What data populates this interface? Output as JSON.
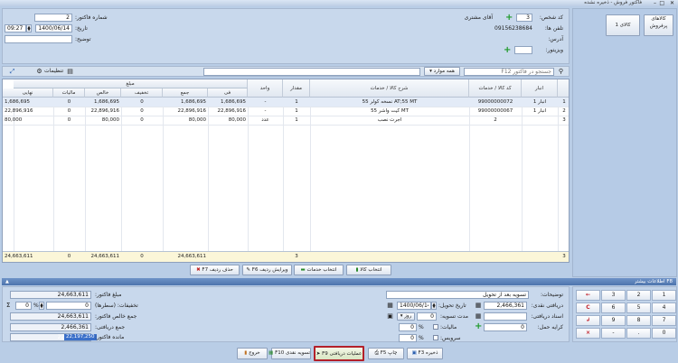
{
  "window": {
    "title": "فاکتور فروش - ذخیره نشده"
  },
  "header": {
    "invoice_number_label": "شماره فاکتور:",
    "invoice_number": "2",
    "date_label": "تاریخ:",
    "date": "1400/06/14",
    "time": "09:27",
    "description_label": "توضیح:",
    "customer_code_label": "کد شخص:",
    "customer_code": "3",
    "customer_name": "آقای مشتری",
    "phone_label": "تلفن ها:",
    "phone": "09156238684",
    "address_label": "آدرس:",
    "visitor_label": "ویزیتور:"
  },
  "side": {
    "price_list_button": "کالاهای پرفروش",
    "goods_button": "کالای 1"
  },
  "toolbar": {
    "search_placeholder": "جستجو در فاکتور F12",
    "all_items_label": "همه موارد",
    "settings_label": "تنظیمات"
  },
  "table": {
    "group_header": "مبلغ",
    "columns": {
      "row": "",
      "warehouse": "انبار",
      "code": "کد کالا / خدمات",
      "desc": "شرح کالا / خدمات",
      "qty": "مقدار",
      "unit": "واحد",
      "fee": "فی",
      "total": "جمع",
      "discount": "تخفیف",
      "net": "خالص",
      "tax": "مالیات",
      "final": "نهایی"
    },
    "rows": [
      {
        "row": "1",
        "warehouse": "انبار 1",
        "code": "99000000072",
        "desc": "نسخه کولر 55 AT;55 MT",
        "qty": "1",
        "unit": "-",
        "fee": "1,686,695",
        "total": "1,686,695",
        "discount": "0",
        "net": "1,686,695",
        "tax": "0",
        "final": "1,686,695"
      },
      {
        "row": "2",
        "warehouse": "انبار 1",
        "code": "99000000067",
        "desc": "کیت واشر 55 MT",
        "qty": "1",
        "unit": "-",
        "fee": "22,896,916",
        "total": "22,896,916",
        "discount": "0",
        "net": "22,896,916",
        "tax": "0",
        "final": "22,896,916"
      },
      {
        "row": "3",
        "warehouse": "",
        "code": "2",
        "desc": "اجرت نصب",
        "qty": "1",
        "unit": "عدد",
        "fee": "80,000",
        "total": "80,000",
        "discount": "0",
        "net": "80,000",
        "tax": "0",
        "final": "80,000"
      }
    ],
    "footer": {
      "row": "3",
      "qty": "3",
      "total": "24,663,611",
      "discount": "0",
      "net": "24,663,611",
      "tax": "0",
      "final": "24,663,611"
    }
  },
  "grid_buttons": {
    "select_goods": "انتخاب کالا",
    "select_services": "انتخاب خدمات",
    "edit_row": "ویرایش ردیف F6",
    "delete_row": "حذف ردیف F7"
  },
  "more_info": {
    "title": "F8 اطلاعات بیشتر"
  },
  "bottom_left": {
    "invoice_amount_label": "مبلغ فاکتور:",
    "invoice_amount": "24,663,611",
    "discounts_label": "تخفیفات: (سطرها)",
    "discount_amount": "0",
    "discount_percent": "0",
    "percent_sign": "%",
    "sigma": "Σ",
    "net_total_label": "جمع خالص فاکتور:",
    "net_total": "24,663,611",
    "received_total_label": "جمع دریافتی:",
    "received_total": "2,466,361",
    "remaining_label": "مانده فاکتور:",
    "remaining": "22,197,250"
  },
  "bottom_right": {
    "notes_label": "توضیحات:",
    "notes": "تسویه بعد از تحویل",
    "cash_received_label": "دریافتی نقدی:",
    "cash_received": "2,466,361",
    "delivery_date_label": "تاریخ تحویل:",
    "delivery_date": "1400/06/14",
    "received_docs_label": "اسناد دریافتی:",
    "settle_period_label": "مدت تسویه:",
    "settle_period": "0",
    "period_unit": "روز",
    "shipping_label": "کرایه حمل:",
    "shipping": "0",
    "tax_label": "مالیات:",
    "tax_percent": "0",
    "service_label": "سرویس:",
    "service_percent": "0",
    "percent_sign": "%"
  },
  "keypad": {
    "keys": [
      "1",
      "2",
      "3",
      "←",
      "4",
      "5",
      "6",
      "C",
      "7",
      "8",
      "9",
      "↲",
      "0",
      ".",
      "-",
      "×"
    ]
  },
  "actions": {
    "save": "ذخیره F3",
    "print": "چاپ F5",
    "receive_ops": "عملیات دریافتی F9",
    "cash_settle": "تسویه نقدی F10",
    "exit": "خروج"
  }
}
